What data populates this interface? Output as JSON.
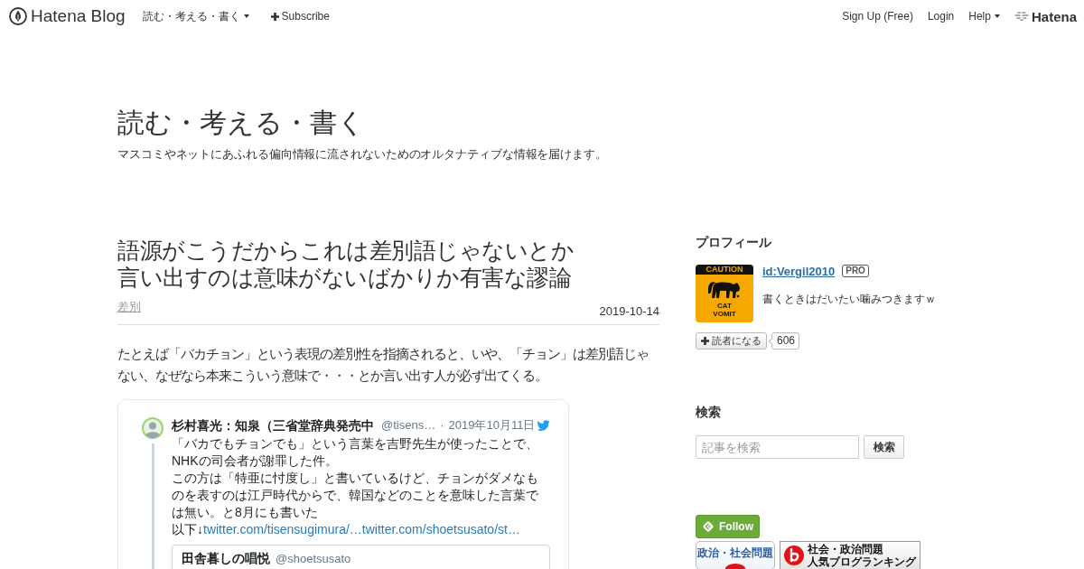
{
  "header": {
    "logo": "Hatena Blog",
    "blog_menu": "読む・考える・書く",
    "subscribe": "Subscribe",
    "links": [
      {
        "label": "Sign Up (Free)",
        "kind": "link"
      },
      {
        "label": "Login",
        "kind": "link"
      },
      {
        "label": "Help",
        "kind": "menu"
      }
    ],
    "brand": "Hatena"
  },
  "blog": {
    "title": "読む・考える・書く",
    "description": "マスコミやネットにあふれる偏向情報に流されないためのオルタナティブな情報を届けます。"
  },
  "article": {
    "title_lines": [
      "語源がこうだからこれは差別語じゃないとか",
      "言い出すのは意味がないばかりか有害な謬論"
    ],
    "category": "差別",
    "date": "2019-10-14",
    "body": "たとえば「バカチョン」という表現の差別性を指摘されると、いや、「チョン」は差別語じゃない、なぜなら本来こういう意味で・・・とか言い出す人が必ず出てくる。",
    "tweet": {
      "author": "杉村喜光：知泉（三省堂辞典発売中",
      "handle": "@tisens…",
      "separator": "·",
      "date": "2019年10月11日",
      "paragraphs": [
        "「バカでもチョンでも」という言葉を吉野先生が使ったことで、\nNHKの司会者が謝罪した件。",
        "この方は「特亜に忖度し」と書いているけど、チョンがダメなものを表すのは江戸時代からで、韓国などのことを意味した言葉では無い。と8月にも書いた"
      ],
      "link_prefix": "以下↓",
      "links": [
        "twitter.com/tisensugimura/…",
        "twitter.com/shoetsusato/st…"
      ],
      "quote": {
        "author": "田舎暮しの唱悦",
        "handle": "@shoetsusato"
      }
    }
  },
  "sidebar": {
    "profile": {
      "heading": "プロフィール",
      "avatar": {
        "top": "CAUTION",
        "bottom": "CAT\nVOMIT"
      },
      "id": "id:Vergil2010",
      "badge": "PRO",
      "bio": "書くときはだいたい噛みつきますｗ",
      "subscribe": "読者になる",
      "subscribers": "606"
    },
    "search": {
      "heading": "検索",
      "placeholder": "記事を検索",
      "button": "検索"
    },
    "follow": "Follow",
    "banners": [
      {
        "kind": "plain",
        "lines": [
          "政治・社会問題"
        ]
      },
      {
        "kind": "ranking",
        "lines": [
          "社会・政治問題",
          "人気ブログランキング"
        ]
      }
    ]
  }
}
